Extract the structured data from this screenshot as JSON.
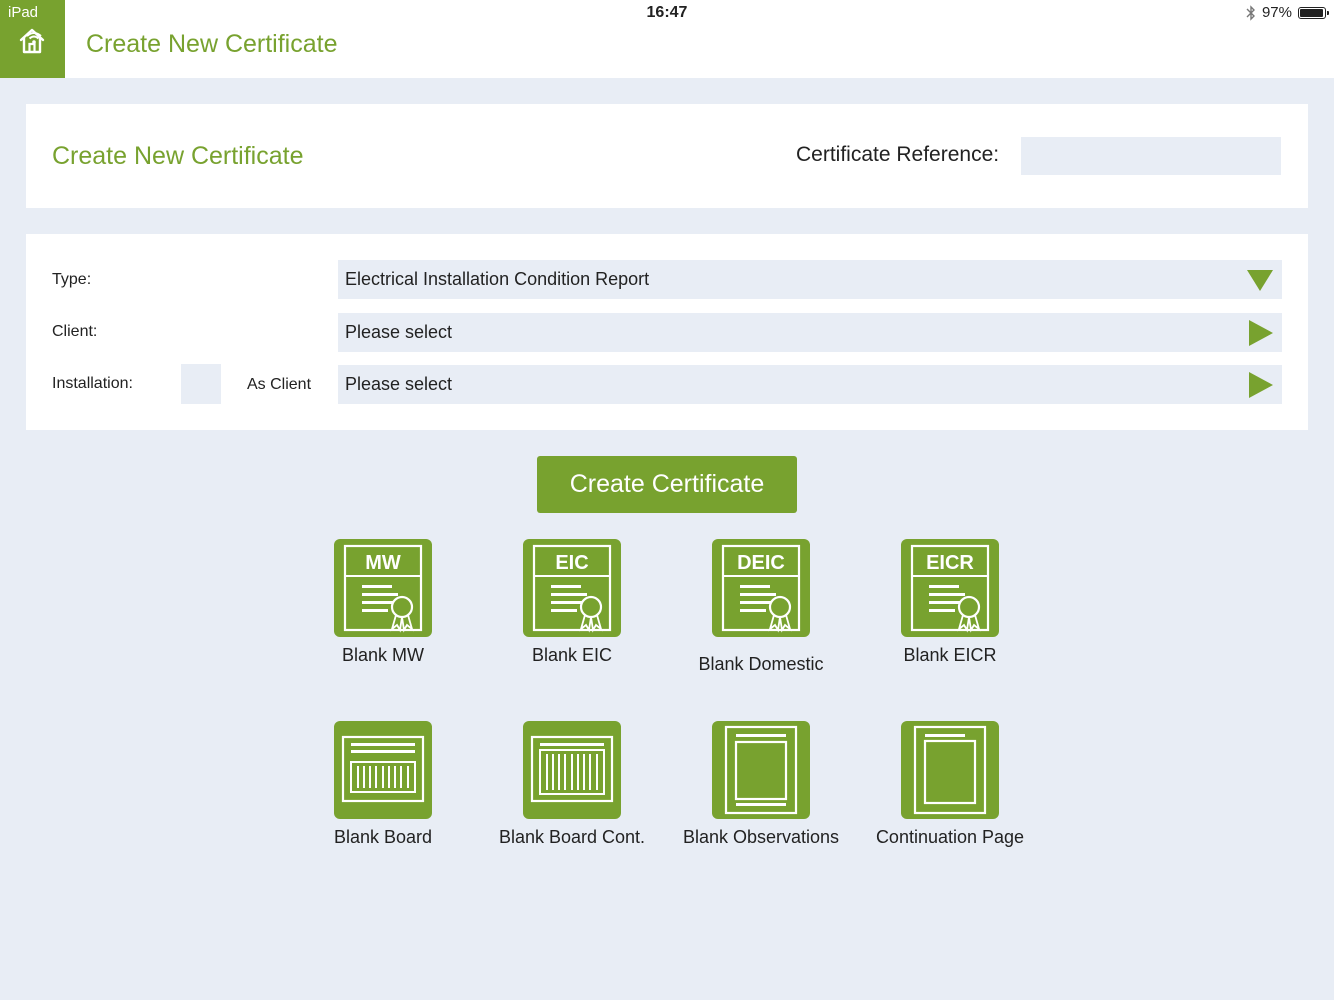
{
  "status_bar": {
    "device": "iPad",
    "time": "16:47",
    "battery": "97%",
    "battery_level": 0.97
  },
  "nav": {
    "title": "Create New Certificate"
  },
  "header_card": {
    "title": "Create New Certificate",
    "reference_label": "Certificate Reference:",
    "reference_value": ""
  },
  "form": {
    "type_label": "Type:",
    "type_value": "Electrical Installation Condition Report",
    "client_label": "Client:",
    "client_value": "Please select",
    "installation_label": "Installation:",
    "as_client_label": "As Client",
    "installation_value": "Please select"
  },
  "create_button": "Create Certificate",
  "tiles": [
    {
      "label": "Blank MW",
      "badge": "MW"
    },
    {
      "label": "Blank EIC",
      "badge": "EIC"
    },
    {
      "label": "Blank Domestic",
      "badge": "DEIC"
    },
    {
      "label": "Blank EICR",
      "badge": "EICR"
    },
    {
      "label": "Blank Board"
    },
    {
      "label": "Blank Board Cont."
    },
    {
      "label": "Blank Observations"
    },
    {
      "label": "Continuation Page"
    }
  ],
  "colors": {
    "accent": "#78a22f",
    "background": "#e8edf5",
    "card": "#ffffff"
  }
}
